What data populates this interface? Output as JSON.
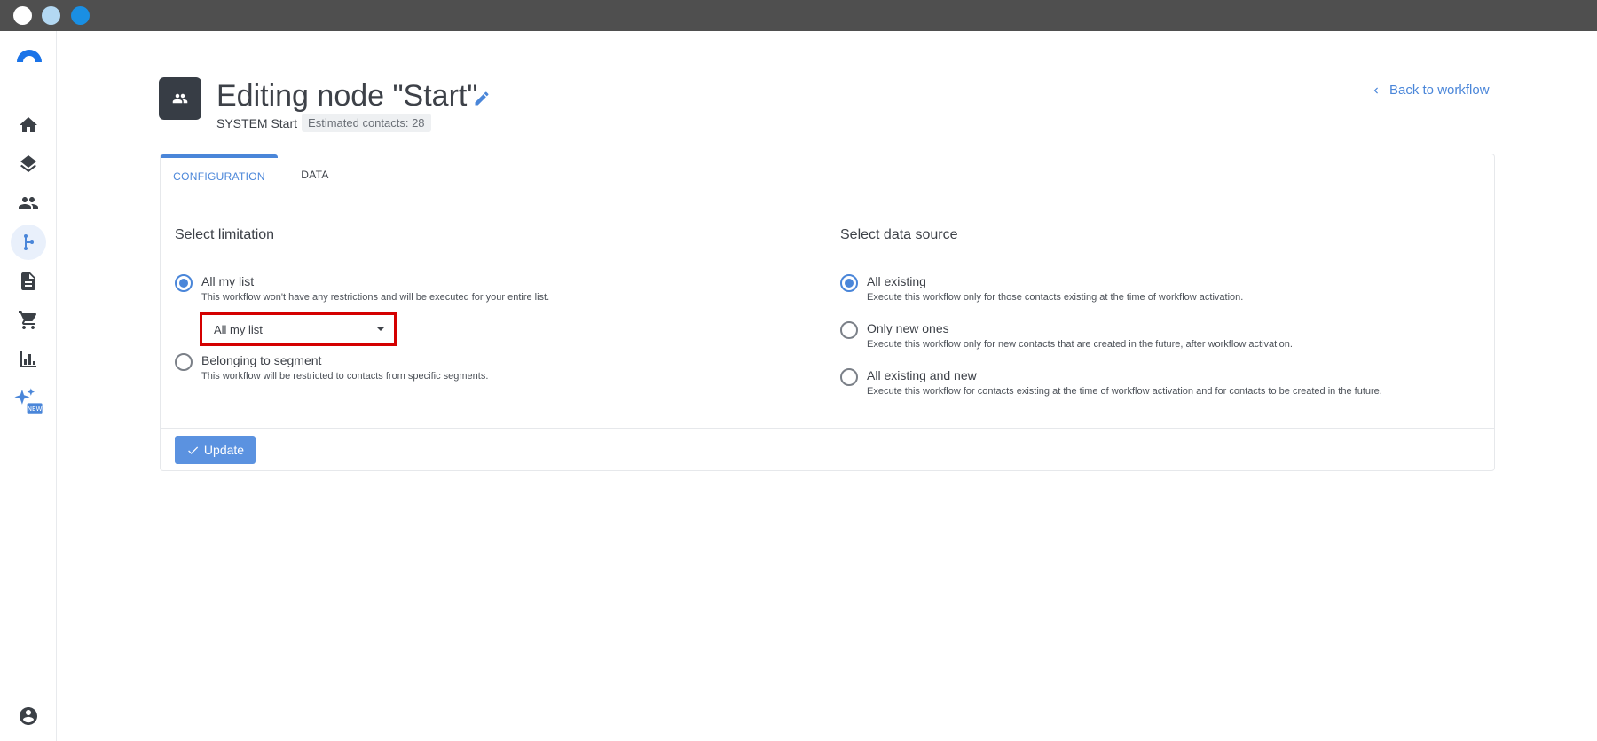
{
  "header": {
    "title": "Editing node \"Start\"",
    "node_type": "SYSTEM Start",
    "estimate": "Estimated contacts: 28",
    "back_label": "Back to workflow"
  },
  "tabs": [
    {
      "label": "CONFIGURATION",
      "active": true
    },
    {
      "label": "DATA",
      "active": false
    }
  ],
  "limitation": {
    "title": "Select limitation",
    "options": [
      {
        "label": "All my list",
        "desc": "This workflow won't have any restrictions and will be executed for your entire list.",
        "checked": true
      },
      {
        "label": "Belonging to segment",
        "desc": "This workflow will be restricted to contacts from specific segments.",
        "checked": false
      }
    ],
    "select_value": "All my list"
  },
  "data_source": {
    "title": "Select data source",
    "options": [
      {
        "label": "All existing",
        "desc": "Execute this workflow only for those contacts existing at the time of workflow activation.",
        "checked": true
      },
      {
        "label": "Only new ones",
        "desc": "Execute this workflow only for new contacts that are created in the future, after workflow activation.",
        "checked": false
      },
      {
        "label": "All existing and new",
        "desc": "Execute this workflow for contacts existing at the time of workflow activation and for contacts to be created in the future.",
        "checked": false
      }
    ]
  },
  "footer": {
    "update_label": "Update"
  },
  "sidebar": {
    "items": [
      {
        "icon": "home-icon"
      },
      {
        "icon": "layers-icon"
      },
      {
        "icon": "people-icon"
      },
      {
        "icon": "workflow-icon",
        "active": true
      },
      {
        "icon": "document-icon"
      },
      {
        "icon": "cart-icon"
      },
      {
        "icon": "bar-chart-icon"
      },
      {
        "icon": "sparkle-new-icon",
        "badge": "NEW"
      }
    ],
    "bottom_icon": "account-circle-icon"
  },
  "colors": {
    "accent": "#4a86d9",
    "highlight": "#d40000",
    "sidebar_icon": "#3b4046",
    "node_icon_bg": "#373d45"
  }
}
